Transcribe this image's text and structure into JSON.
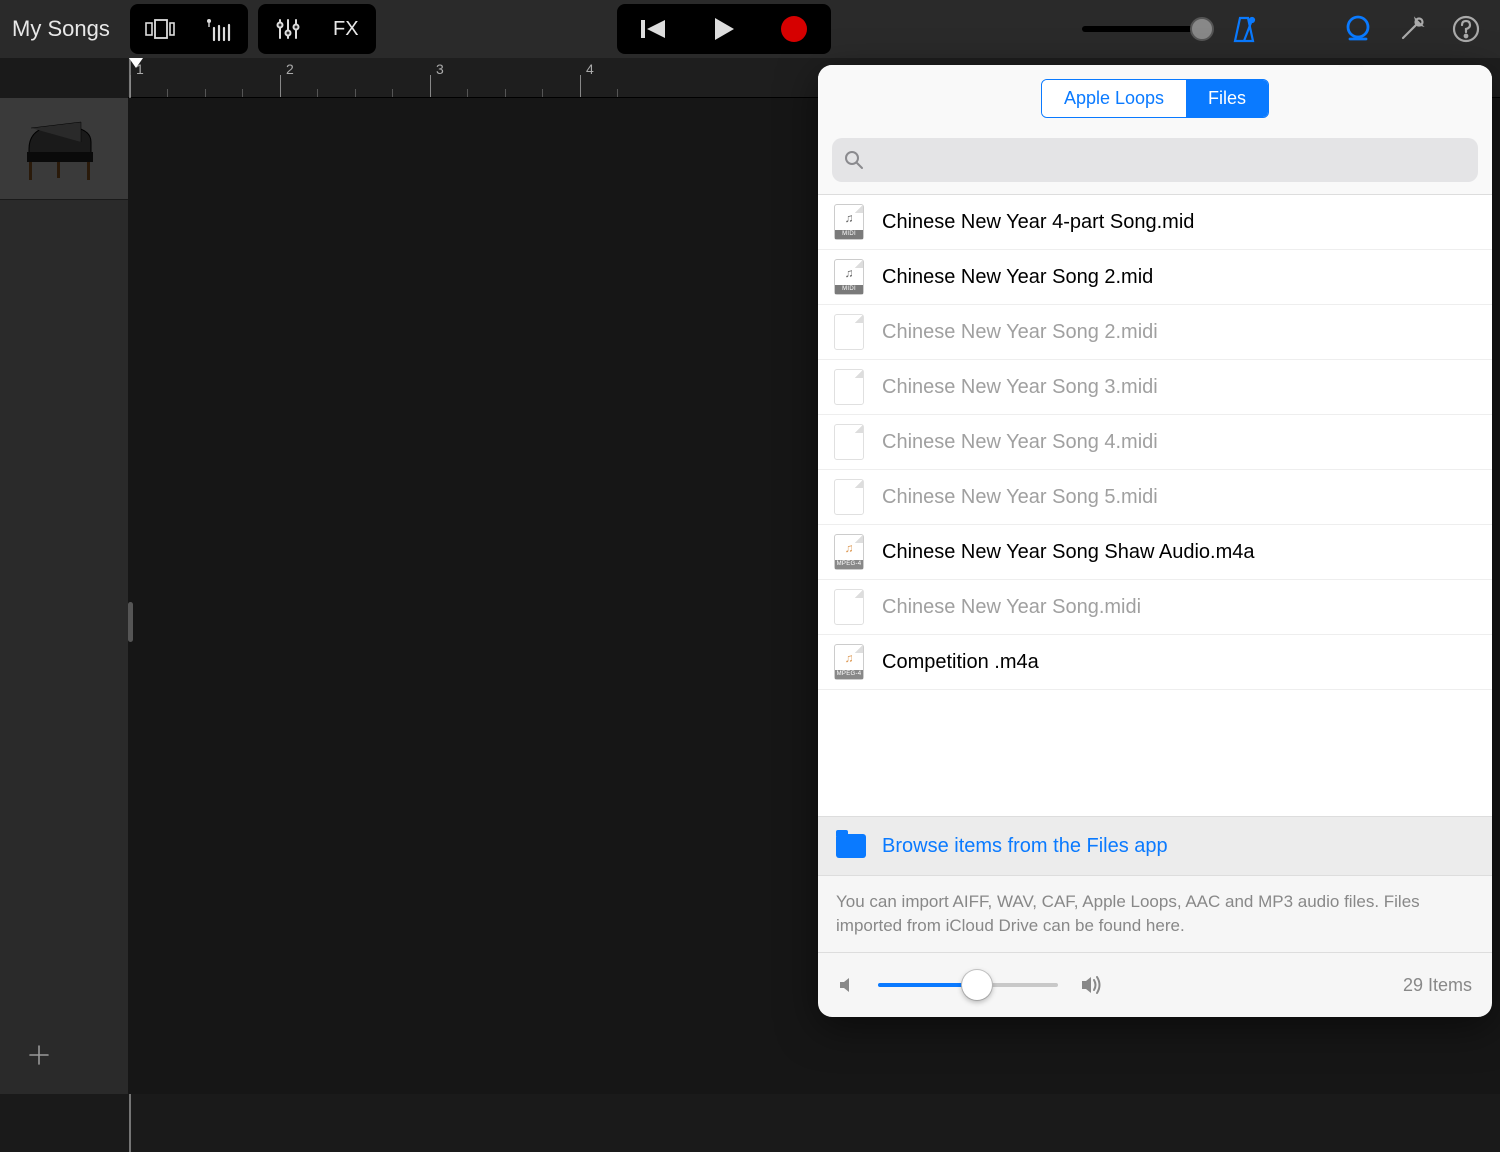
{
  "header": {
    "title": "My Songs",
    "fx_label": "FX"
  },
  "ruler": {
    "bars": [
      "1",
      "2",
      "3",
      "4"
    ]
  },
  "popover": {
    "tabs": {
      "loops": "Apple Loops",
      "files": "Files"
    },
    "search_placeholder": "",
    "files": [
      {
        "name": "Chinese New Year 4-part Song.mid",
        "type": "midi",
        "enabled": true
      },
      {
        "name": "Chinese New Year Song 2.mid",
        "type": "midi",
        "enabled": true
      },
      {
        "name": "Chinese New Year Song 2.midi",
        "type": "generic",
        "enabled": false
      },
      {
        "name": "Chinese New Year Song 3.midi",
        "type": "generic",
        "enabled": false
      },
      {
        "name": "Chinese New Year Song 4.midi",
        "type": "generic",
        "enabled": false
      },
      {
        "name": "Chinese New Year Song 5.midi",
        "type": "generic",
        "enabled": false
      },
      {
        "name": "Chinese New Year Song Shaw Audio.m4a",
        "type": "mpeg4",
        "enabled": true
      },
      {
        "name": "Chinese New Year Song.midi",
        "type": "generic",
        "enabled": false
      },
      {
        "name": "Competition .m4a",
        "type": "mpeg4",
        "enabled": true
      }
    ],
    "browse_label": "Browse items from the Files app",
    "info_text": "You can import AIFF, WAV, CAF, Apple Loops, AAC and MP3 audio files. Files imported from iCloud Drive can be found here.",
    "item_count": "29 Items",
    "badges": {
      "midi": "MIDI",
      "mpeg4": "MPEG-4"
    }
  }
}
